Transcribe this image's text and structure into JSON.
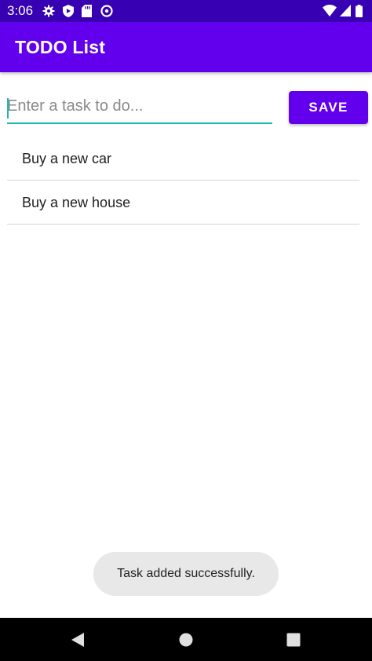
{
  "status_bar": {
    "time": "3:06",
    "left_icons": [
      "settings-icon",
      "play-protect-icon",
      "sd-card-icon",
      "data-saver-icon"
    ],
    "right_icons": [
      "wifi-icon",
      "signal-icon",
      "battery-icon"
    ]
  },
  "app_bar": {
    "title": "TODO List"
  },
  "input": {
    "placeholder": "Enter a task to do...",
    "value": ""
  },
  "save_button": {
    "label": "SAVE"
  },
  "tasks": [
    {
      "label": "Buy a new car"
    },
    {
      "label": "Buy a new house"
    }
  ],
  "toast": {
    "message": "Task added successfully."
  },
  "nav_bar": {
    "buttons": [
      "back-icon",
      "home-icon",
      "recents-icon"
    ]
  },
  "colors": {
    "status_bar": "#3700b3",
    "primary": "#6200ee",
    "accent": "#1dbab3"
  }
}
